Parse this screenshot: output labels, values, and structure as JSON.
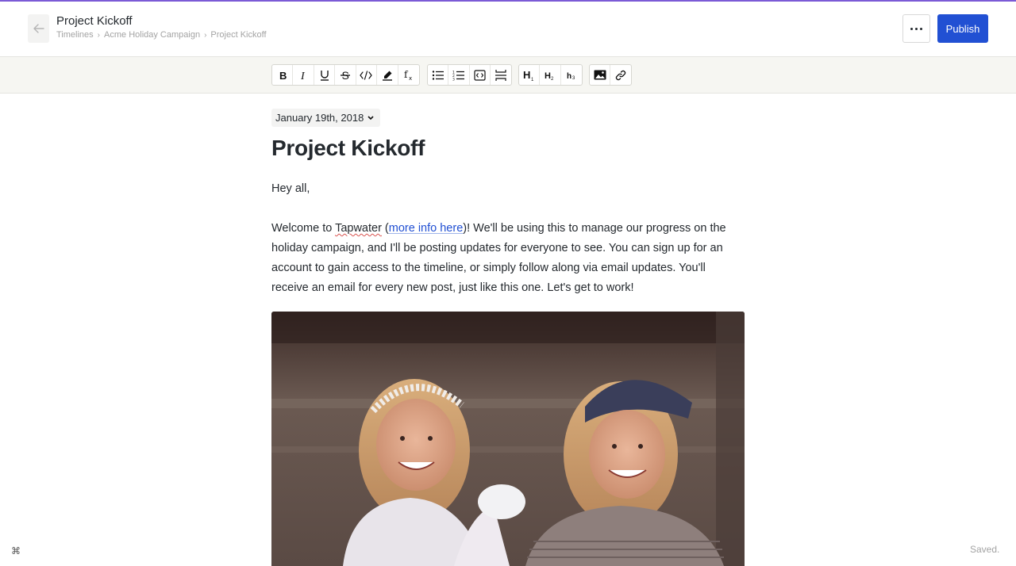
{
  "header": {
    "title": "Project Kickoff",
    "breadcrumb": [
      "Timelines",
      "Acme Holiday Campaign",
      "Project Kickoff"
    ],
    "publish_label": "Publish",
    "more_icon": "ellipsis-icon",
    "back_icon": "arrow-left-icon"
  },
  "toolbar": {
    "groups": [
      [
        "bold-icon",
        "italic-icon",
        "underline-icon",
        "strikethrough-icon",
        "code-icon",
        "highlight-icon",
        "formula-icon"
      ],
      [
        "bullet-list-icon",
        "numbered-list-icon",
        "code-block-icon",
        "divider-icon"
      ],
      [
        "heading-1-icon",
        "heading-2-icon",
        "heading-3-icon"
      ],
      [
        "image-icon",
        "link-icon"
      ]
    ]
  },
  "document": {
    "date": "January 19th, 2018",
    "title": "Project Kickoff",
    "greeting": "Hey all,",
    "body_prefix": "Welcome to ",
    "brand_word": "Tapwater",
    "paren_open": " (",
    "link_text": "more info here",
    "body_suffix": ")! We'll be using this to manage our progress on the holiday campaign, and I'll be posting updates for everyone to see. You can sign up for an account to gain access to the timeline, or simply follow along via email updates. You'll receive an email for every new post, just like this one. Let's get to work!"
  },
  "footer": {
    "shortcut_glyph": "⌘",
    "status": "Saved."
  },
  "colors": {
    "accent": "#7b5ad6",
    "publish": "#2150d3",
    "toolbar_bg": "#f6f6f2"
  }
}
